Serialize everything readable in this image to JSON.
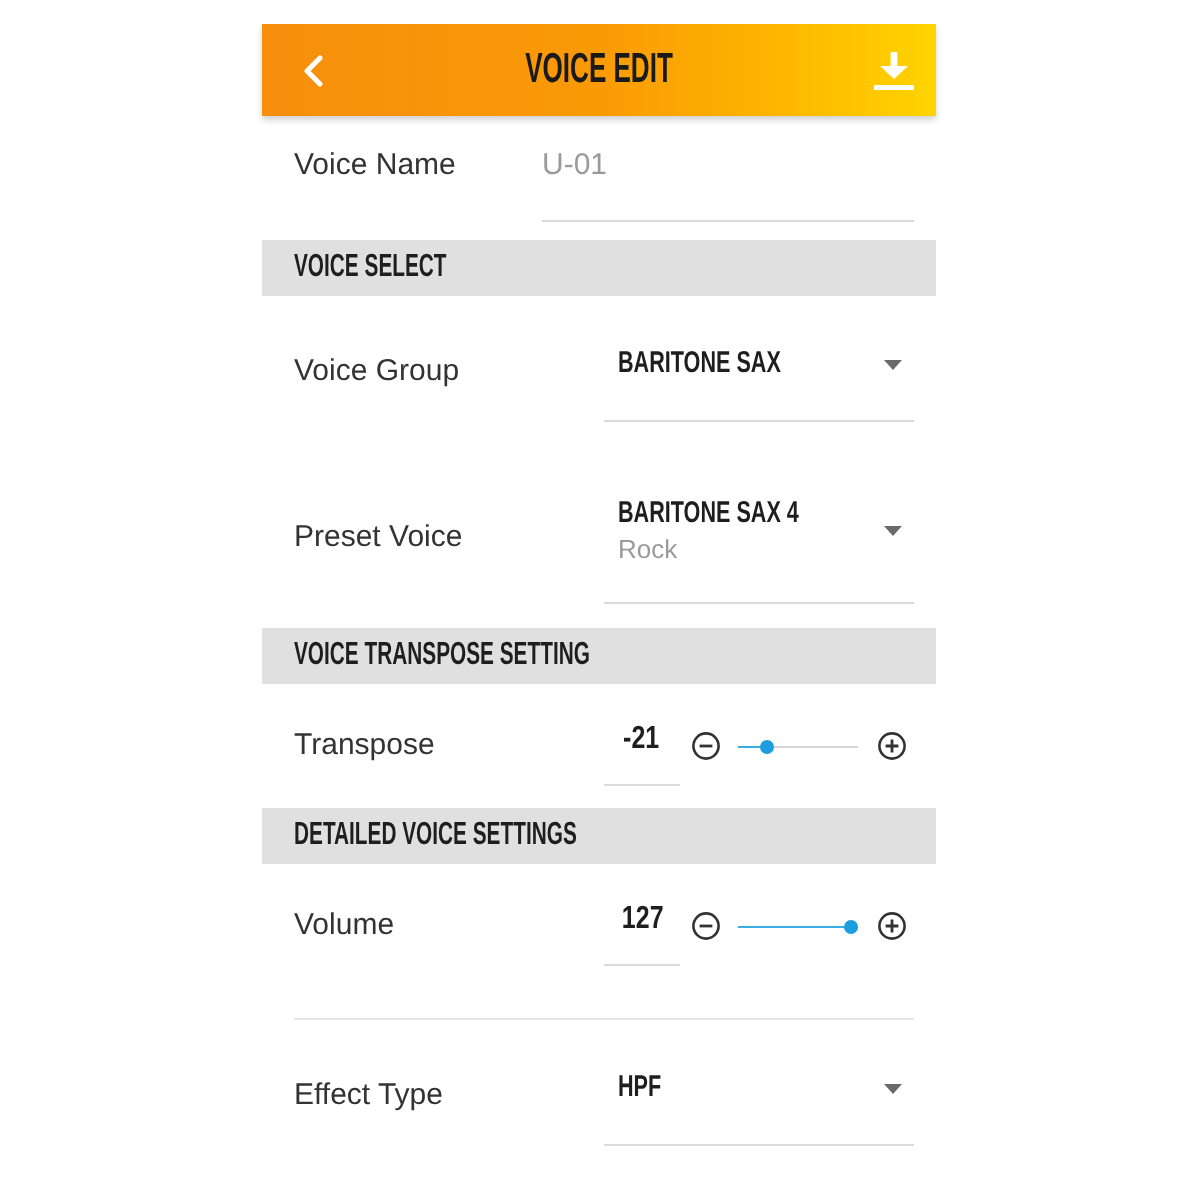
{
  "header": {
    "title": "VOICE EDIT"
  },
  "voice_name": {
    "label": "Voice Name",
    "placeholder": "U-01"
  },
  "sections": [
    {
      "title": "VOICE SELECT",
      "rows": [
        {
          "kind": "select",
          "label": "Voice Group",
          "value": "BARITONE SAX"
        },
        {
          "kind": "select",
          "label": "Preset Voice",
          "value": "BARITONE SAX 4",
          "subtitle": "Rock"
        }
      ]
    },
    {
      "title": "VOICE TRANSPOSE SETTING",
      "rows": [
        {
          "kind": "slider",
          "label": "Transpose",
          "value": "-21",
          "level": 0.2
        }
      ]
    },
    {
      "title": "DETAILED VOICE SETTINGS",
      "rows": [
        {
          "kind": "slider",
          "label": "Volume",
          "value": "127",
          "level": 1
        },
        {
          "kind": "select",
          "label": "Effect Type",
          "value": "HPF"
        }
      ]
    }
  ]
}
